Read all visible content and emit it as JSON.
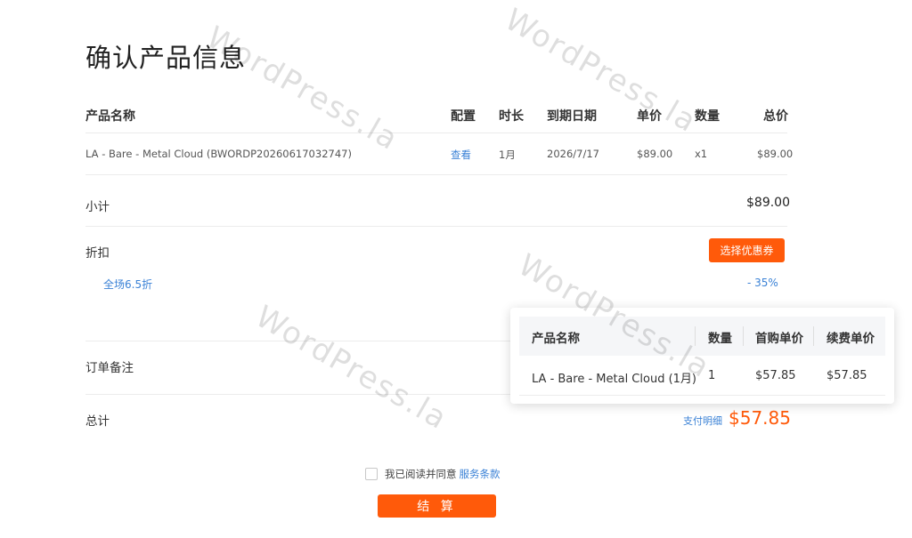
{
  "page": {
    "title": "确认产品信息"
  },
  "product_table": {
    "headers": {
      "name": "产品名称",
      "config": "配置",
      "duration": "时长",
      "expiry": "到期日期",
      "unit_price": "单价",
      "quantity": "数量",
      "total": "总价"
    },
    "rows": [
      {
        "name": "LA - Bare - Metal Cloud (BWORDP20260617032747)",
        "config": "查看",
        "duration": "1月",
        "expiry": "2026/7/17",
        "unit_price": "$89.00",
        "quantity": "x1",
        "total": "$89.00"
      }
    ]
  },
  "subtotal": {
    "label": "小计",
    "value": "$89.00"
  },
  "discount": {
    "label": "折扣",
    "coupon_button": "选择优惠券",
    "item_name": "全场6.5折",
    "item_value": "- 35%"
  },
  "notes": {
    "label": "订单备注"
  },
  "total": {
    "label": "总计",
    "detail_link": "支付明细",
    "value": "$57.85"
  },
  "agreement": {
    "text": "我已阅读并同意",
    "link": "服务条款"
  },
  "checkout": {
    "label": "结 算"
  },
  "payment_popup": {
    "headers": {
      "name": "产品名称",
      "quantity": "数量",
      "first_price": "首购单价",
      "renew_price": "续费单价"
    },
    "rows": [
      {
        "name": "LA - Bare - Metal Cloud (1月)",
        "quantity": "1",
        "first_price": "$57.85",
        "renew_price": "$57.85"
      }
    ]
  },
  "watermark": {
    "text": "WordPress.la"
  },
  "colors": {
    "accent": "#ff5a0a",
    "link": "#3b82d6",
    "text": "#222222",
    "divider": "#ececec"
  }
}
